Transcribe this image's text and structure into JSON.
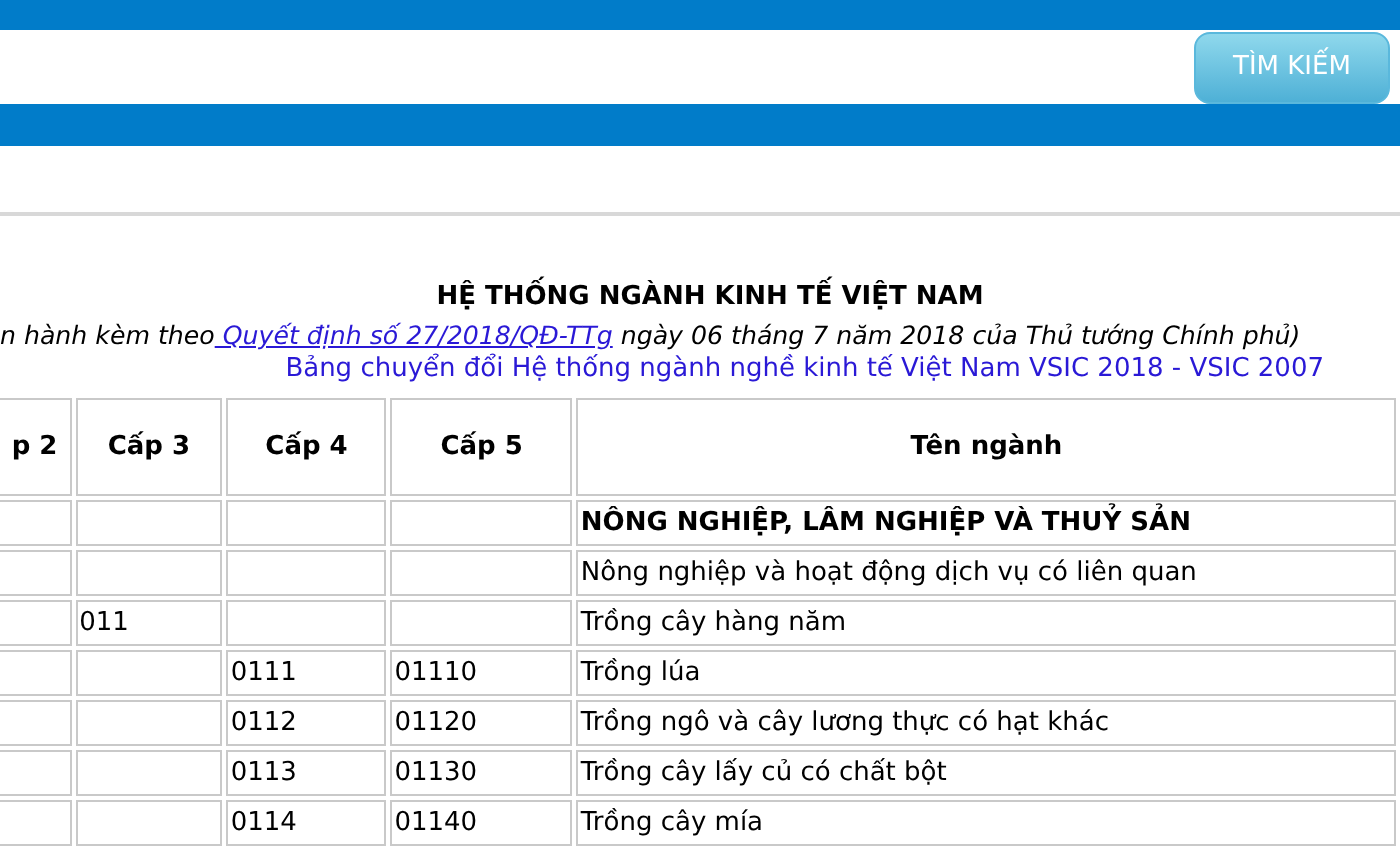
{
  "search": {
    "button": "TÌM KIẾM"
  },
  "heading": {
    "title": "HỆ THỐNG NGÀNH KINH TẾ VIỆT NAM",
    "subtitle_before": "n hành kèm theo",
    "subtitle_link": " Quyết định số 27/2018/QĐ-TTg",
    "subtitle_after": " ngày 06 tháng 7 năm 2018 của Thủ tướng Chính phủ)",
    "conversion_link": "Bảng chuyển đổi Hệ thống ngành nghề kinh tế Việt Nam VSIC 2018 - VSIC 2007"
  },
  "table": {
    "columns": [
      "p 2",
      "Cấp 3",
      "Cấp 4",
      "Cấp 5",
      "Tên ngành"
    ],
    "rows": [
      {
        "kind": "section",
        "cells": [
          "",
          "",
          "",
          "",
          "NÔNG NGHIỆP, LÂM NGHIỆP VÀ THUỶ SẢN"
        ]
      },
      {
        "kind": "plain",
        "cells": [
          "",
          "",
          "",
          "",
          "Nông nghiệp và hoạt động dịch vụ có liên quan"
        ]
      },
      {
        "kind": "plain",
        "cells": [
          "",
          "011",
          "",
          "",
          "Trồng cây hàng năm"
        ]
      },
      {
        "kind": "plain",
        "cells": [
          "",
          "",
          "0111",
          "01110",
          "Trồng lúa"
        ]
      },
      {
        "kind": "plain",
        "cells": [
          "",
          "",
          "0112",
          "01120",
          "Trồng ngô và cây lương thực có hạt khác"
        ]
      },
      {
        "kind": "plain",
        "cells": [
          "",
          "",
          "0113",
          "01130",
          "Trồng cây lấy củ có chất bột"
        ]
      },
      {
        "kind": "plain",
        "cells": [
          "",
          "",
          "0114",
          "01140",
          "Trồng cây mía"
        ]
      }
    ]
  }
}
